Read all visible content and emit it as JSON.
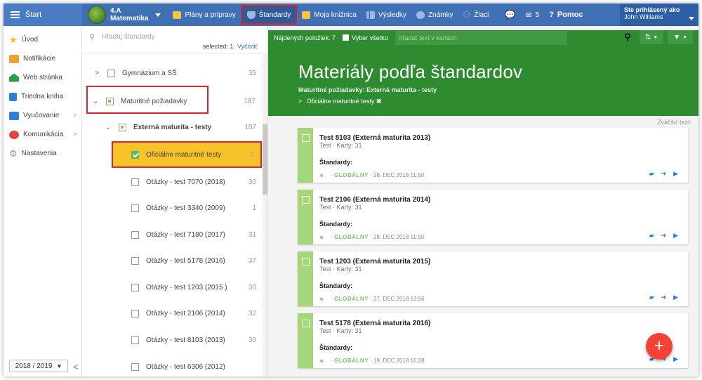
{
  "topbar": {
    "start_label": "Štart",
    "class_name": "4.A",
    "class_subject": "Matematika",
    "nav": [
      {
        "label": "Plány a prípravy",
        "icon": "briefcase-icon",
        "color": "#f5c242"
      },
      {
        "label": "Štandardy",
        "icon": "shield-icon",
        "color": "#9fb8dc"
      },
      {
        "label": "Moja knižnica",
        "icon": "library-icon",
        "color": "#f5c242"
      },
      {
        "label": "Výsledky",
        "icon": "bar-chart-icon",
        "color": "#9fb8dc"
      },
      {
        "label": "Známky",
        "icon": "grade-icon",
        "color": "#9fb8dc"
      },
      {
        "label": "Žiaci",
        "icon": "students-icon",
        "color": "#9fb8dc"
      }
    ],
    "messages_count": "5",
    "help_label": "Pomoc",
    "user_prefix": "Ste prihlásený ako",
    "user_name": "John Williams"
  },
  "sidebar": {
    "items": [
      {
        "label": "Úvod",
        "icon": "star-icon",
        "color": "#f5b820"
      },
      {
        "label": "Notifikácie",
        "icon": "mail-icon",
        "color": "#f0a030"
      },
      {
        "label": "Web stránka",
        "icon": "home-icon",
        "color": "#2e9c49"
      },
      {
        "label": "Triedna kniha",
        "icon": "book-icon",
        "color": "#2f7ed8"
      },
      {
        "label": "Vyučovanie",
        "icon": "teaching-icon",
        "color": "#2f7ed8"
      },
      {
        "label": "Komunikácia",
        "icon": "chat-icon",
        "color": "#e04545"
      },
      {
        "label": "Nastavenia",
        "icon": "gear-icon",
        "color": "#999999"
      }
    ],
    "year": "2018 / 2019"
  },
  "tree": {
    "search_placeholder": "Hľadaj štandardy",
    "selected_label": "selected: 1",
    "clear_label": "Vyčistiť",
    "rows": [
      {
        "label": "Gymnázium a SŠ",
        "count": "35"
      },
      {
        "label": "Maturitné požiadavky",
        "count": "187"
      },
      {
        "label": "Externá maturita - testy",
        "count": "187"
      },
      {
        "label": "Oficiálne maturitné testy",
        "count": "7"
      },
      {
        "label": "Otázky - test 7070 (2018)",
        "count": "30"
      },
      {
        "label": "Otázky - test 3340 (2009)",
        "count": "1"
      },
      {
        "label": "Otázky - test 7180 (2017)",
        "count": "31"
      },
      {
        "label": "Otázky - test 5178 (2016)",
        "count": "37"
      },
      {
        "label": "Otázky - test 1203 (2015 )",
        "count": "30"
      },
      {
        "label": "Otázky - test 2106 (2014)",
        "count": "32"
      },
      {
        "label": "Otázky - test 8103 (2013)",
        "count": "30"
      },
      {
        "label": "Otázky - test 6306 (2012)",
        "count": ""
      }
    ]
  },
  "main": {
    "found_label": "Nájdených položiek: 7",
    "select_all_label": "Vyber všetko",
    "filter_placeholder": "hľadať text v kartách",
    "title": "Materiály podľa štandardov",
    "breadcrumb_parent": "Maturitné požiadavky: Externá maturita - testy",
    "breadcrumb_active": "Oficiálne maturitné testy",
    "zoom_label": "Zväčšiť text:",
    "cards": [
      {
        "title": "Test 8103 (Externá maturita 2013)",
        "sub": "Test · Karty: 31",
        "std": "Štandardy:",
        "scope": "GLOBÁLNY",
        "date": "28. DEC 2018 11:50"
      },
      {
        "title": "Test 2106 (Externá maturita 2014)",
        "sub": "Test · Karty: 31",
        "std": "Štandardy:",
        "scope": "GLOBÁLNY",
        "date": "28. DEC 2018 11:50"
      },
      {
        "title": "Test 1203 (Externá maturita 2015)",
        "sub": "Test · Karty: 31",
        "std": "Štandardy:",
        "scope": "GLOBÁLNY",
        "date": "27. DEC 2018 13:56"
      },
      {
        "title": "Test 5178 (Externá maturita 2016)",
        "sub": "Test · Karty: 31",
        "std": "Štandardy:",
        "scope": "GLOBÁLNY",
        "date": "19. DEC 2018 16:28"
      }
    ]
  },
  "colors": {
    "topbar": "#3f6fb5",
    "header_green": "#2e8b30",
    "highlight": "#f6c42a",
    "annotation_red": "#d7262d",
    "fab": "#f44336"
  }
}
